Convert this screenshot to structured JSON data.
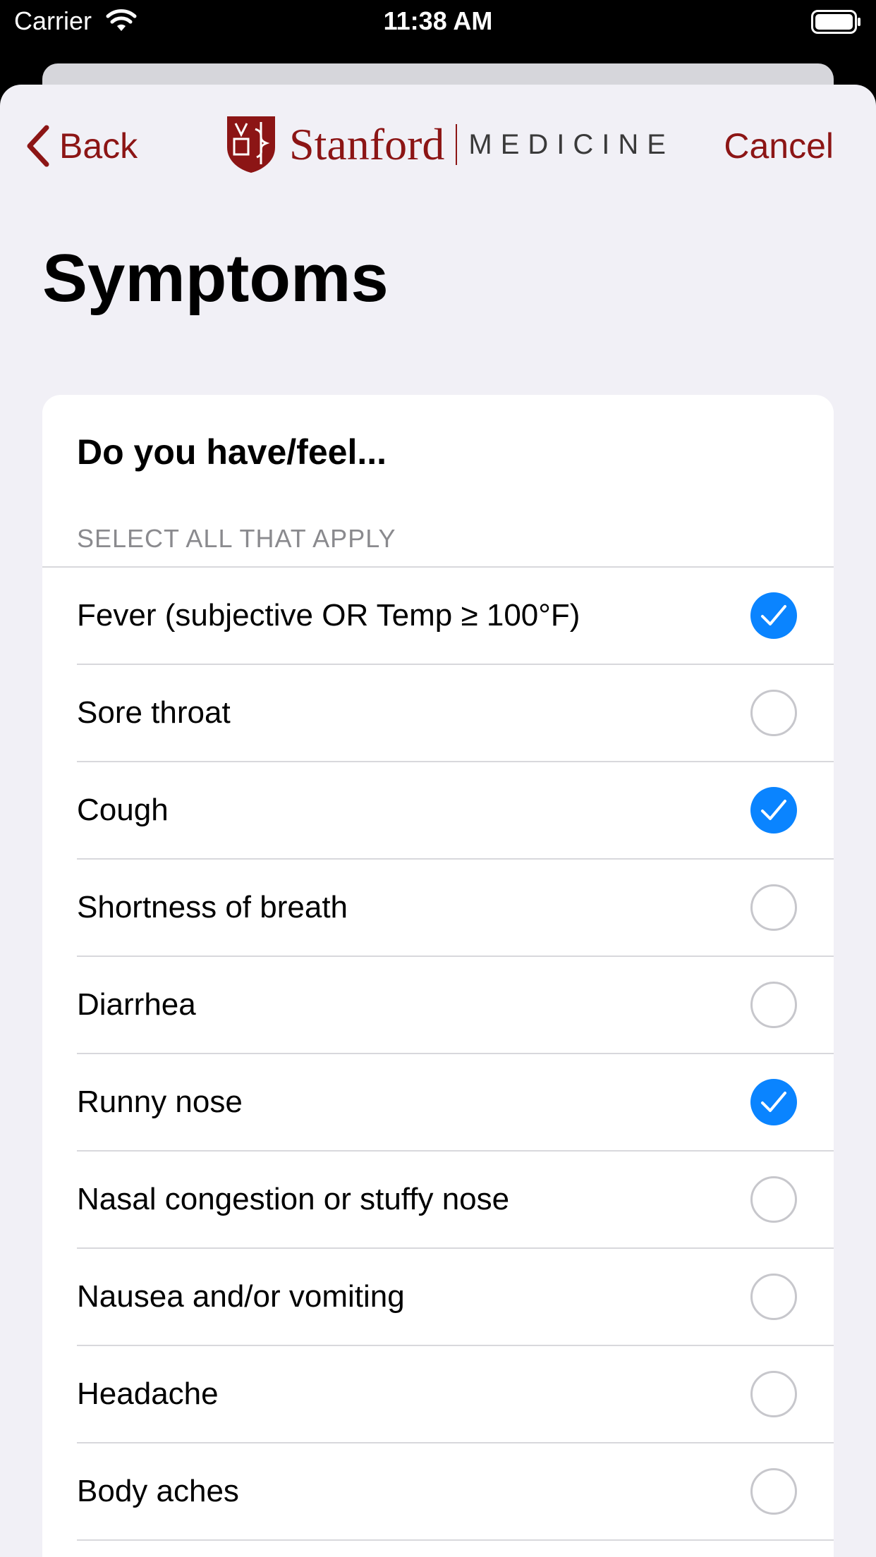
{
  "status_bar": {
    "carrier": "Carrier",
    "time": "11:38 AM"
  },
  "nav": {
    "back_label": "Back",
    "cancel_label": "Cancel",
    "logo_name": "Stanford",
    "logo_sub": "MEDICINE"
  },
  "page": {
    "title": "Symptoms"
  },
  "question": {
    "text": "Do you have/feel...",
    "instruction": "SELECT ALL THAT APPLY",
    "options": [
      {
        "label": "Fever (subjective OR Temp ≥ 100°F)",
        "selected": true
      },
      {
        "label": "Sore throat",
        "selected": false
      },
      {
        "label": "Cough",
        "selected": true
      },
      {
        "label": "Shortness of breath",
        "selected": false
      },
      {
        "label": "Diarrhea",
        "selected": false
      },
      {
        "label": "Runny nose",
        "selected": true
      },
      {
        "label": "Nasal congestion or stuffy nose",
        "selected": false
      },
      {
        "label": "Nausea and/or vomiting",
        "selected": false
      },
      {
        "label": "Headache",
        "selected": false
      },
      {
        "label": "Body aches",
        "selected": false
      }
    ]
  },
  "colors": {
    "accent": "#8c1515",
    "check": "#0a84ff"
  }
}
